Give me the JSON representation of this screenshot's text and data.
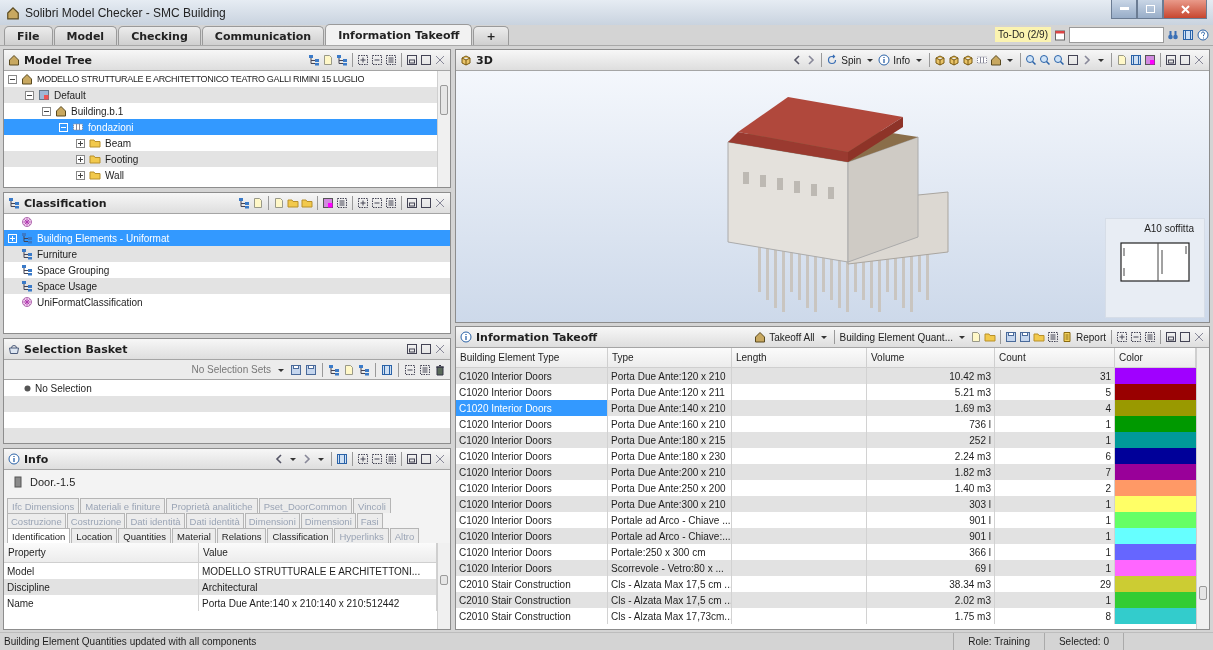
{
  "window": {
    "title": "Solibri Model Checker - SMC Building"
  },
  "menu_tabs": [
    {
      "label": "File",
      "selected": false
    },
    {
      "label": "Model",
      "selected": false
    },
    {
      "label": "Checking",
      "selected": false
    },
    {
      "label": "Communication",
      "selected": false
    },
    {
      "label": "Information Takeoff",
      "selected": true
    },
    {
      "label": "+",
      "selected": false
    }
  ],
  "todo": {
    "label": "To-Do (2/9)"
  },
  "model_tree": {
    "title": "Model Tree",
    "items": [
      {
        "label": "MODELLO STRUTTURALE E ARCHITETTONICO TEATRO GALLI RIMINI 15 LUGLIO",
        "kind": "model",
        "expanded": true,
        "selected": false,
        "children": [
          {
            "label": "Default",
            "kind": "layer",
            "expanded": true,
            "selected": false,
            "children": [
              {
                "label": "Building.b.1",
                "kind": "building",
                "expanded": true,
                "selected": false,
                "children": [
                  {
                    "label": "fondazioni",
                    "kind": "storey",
                    "expanded": true,
                    "selected": true,
                    "children": [
                      {
                        "label": "Beam",
                        "kind": "folder",
                        "expanded": false,
                        "selected": false
                      },
                      {
                        "label": "Footing",
                        "kind": "folder",
                        "expanded": false,
                        "selected": false
                      },
                      {
                        "label": "Wall",
                        "kind": "folder",
                        "expanded": false,
                        "selected": false
                      }
                    ]
                  }
                ]
              }
            ]
          }
        ]
      }
    ]
  },
  "classification": {
    "title": "Classification",
    "items": [
      {
        "kind": "set",
        "selected": false
      },
      {
        "label": "Building Elements - Uniformat",
        "kind": "group",
        "selected": true,
        "expanded": false
      },
      {
        "label": "Furniture",
        "kind": "group",
        "selected": false
      },
      {
        "label": "Space Grouping",
        "kind": "group",
        "selected": false
      },
      {
        "label": "Space Usage",
        "kind": "group",
        "selected": false
      },
      {
        "label": "UniFormatClassification",
        "kind": "set",
        "selected": false
      }
    ]
  },
  "selection_basket": {
    "title": "Selection Basket",
    "sets_dropdown": "No Selection Sets",
    "items": [
      {
        "label": "No Selection"
      }
    ]
  },
  "info": {
    "title": "Info",
    "object": "Door.-1.5",
    "tab_rows": [
      {
        "tabs": [
          {
            "label": "Ifc Dimensions",
            "disabled": true,
            "selected": false
          },
          {
            "label": "Materiali e finiture",
            "disabled": true,
            "selected": false
          },
          {
            "label": "Proprietà analitiche",
            "disabled": true,
            "selected": false
          },
          {
            "label": "Pset_DoorCommon",
            "disabled": true,
            "selected": false
          },
          {
            "label": "Vincoli",
            "disabled": true,
            "selected": false
          }
        ]
      },
      {
        "tabs": [
          {
            "label": "Costruzione",
            "disabled": true,
            "selected": false
          },
          {
            "label": "Costruzione",
            "disabled": true,
            "selected": false
          },
          {
            "label": "Dati identità",
            "disabled": true,
            "selected": false
          },
          {
            "label": "Dati identità",
            "disabled": true,
            "selected": false
          },
          {
            "label": "Dimensioni",
            "disabled": true,
            "selected": false
          },
          {
            "label": "Dimensioni",
            "disabled": true,
            "selected": false
          },
          {
            "label": "Fasi",
            "disabled": true,
            "selected": false
          }
        ]
      },
      {
        "tabs": [
          {
            "label": "Identification",
            "disabled": false,
            "selected": true
          },
          {
            "label": "Location",
            "disabled": false,
            "selected": false
          },
          {
            "label": "Quantities",
            "disabled": false,
            "selected": false
          },
          {
            "label": "Material",
            "disabled": false,
            "selected": false
          },
          {
            "label": "Relations",
            "disabled": false,
            "selected": false
          },
          {
            "label": "Classification",
            "disabled": false,
            "selected": false
          },
          {
            "label": "Hyperlinks",
            "disabled": true,
            "selected": false
          },
          {
            "label": "Altro",
            "disabled": true,
            "selected": false
          }
        ]
      }
    ],
    "columns": [
      "Property",
      "Value"
    ],
    "rows": [
      [
        "Model",
        "MODELLO STRUTTURALE E ARCHITETTONI..."
      ],
      [
        "Discipline",
        "Architectural"
      ],
      [
        "Name",
        "Porta Due Ante:140 x 210:140 x 210:512442"
      ]
    ]
  },
  "view_3d": {
    "title": "3D",
    "spin": "Spin",
    "info": "Info",
    "minimap": {
      "label": "A10 soffitta"
    }
  },
  "takeoff": {
    "title": "Information Takeoff",
    "takeoff_all": "Takeoff All",
    "preset": "Building Element Quant...",
    "report": "Report",
    "columns": [
      "Building Element Type",
      "Type",
      "Length",
      "Volume",
      "Count",
      "Color"
    ],
    "rows": [
      {
        "element": "C1020 Interior Doors",
        "type": "Porta Due Ante:120 x 210",
        "volume": "10.42 m3",
        "count": "31",
        "color": "#a000ff",
        "selected": false
      },
      {
        "element": "C1020 Interior Doors",
        "type": "Porta Due Ante:120 x 211",
        "volume": "5.21 m3",
        "count": "5",
        "color": "#990000",
        "selected": false
      },
      {
        "element": "C1020 Interior Doors",
        "type": "Porta Due Ante:140 x 210",
        "volume": "1.69 m3",
        "count": "4",
        "color": "#999900",
        "selected": true
      },
      {
        "element": "C1020 Interior Doors",
        "type": "Porta Due Ante:160 x 210",
        "volume": "736 l",
        "count": "1",
        "color": "#009900",
        "selected": false
      },
      {
        "element": "C1020 Interior Doors",
        "type": "Porta Due Ante:180 x 215",
        "volume": "252 l",
        "count": "1",
        "color": "#009999",
        "selected": false
      },
      {
        "element": "C1020 Interior Doors",
        "type": "Porta Due Ante:180 x 230",
        "volume": "2.24 m3",
        "count": "6",
        "color": "#000099",
        "selected": false
      },
      {
        "element": "C1020 Interior Doors",
        "type": "Porta Due Ante:200 x 210",
        "volume": "1.82 m3",
        "count": "7",
        "color": "#990099",
        "selected": false
      },
      {
        "element": "C1020 Interior Doors",
        "type": "Porta Due Ante:250 x 200",
        "volume": "1.40 m3",
        "count": "2",
        "color": "#ff9966",
        "selected": false
      },
      {
        "element": "C1020 Interior Doors",
        "type": "Porta Due Ante:300 x 210",
        "volume": "303 l",
        "count": "1",
        "color": "#ffff66",
        "selected": false
      },
      {
        "element": "C1020 Interior Doors",
        "type": "Portale ad Arco - Chiave ...",
        "volume": "901 l",
        "count": "1",
        "color": "#66ff66",
        "selected": false
      },
      {
        "element": "C1020 Interior Doors",
        "type": "Portale ad Arco - Chiave:...",
        "volume": "901 l",
        "count": "1",
        "color": "#66ffff",
        "selected": false
      },
      {
        "element": "C1020 Interior Doors",
        "type": "Portale:250 x 300 cm",
        "volume": "366 l",
        "count": "1",
        "color": "#6666ff",
        "selected": false
      },
      {
        "element": "C1020 Interior Doors",
        "type": "Scorrevole -  Vetro:80 x ...",
        "volume": "69 l",
        "count": "1",
        "color": "#ff66ff",
        "selected": false
      },
      {
        "element": "C2010 Stair Construction",
        "type": "Cls - Alzata Max 17,5 cm ...",
        "volume": "38.34 m3",
        "count": "29",
        "color": "#cccc33",
        "selected": false
      },
      {
        "element": "C2010 Stair Construction",
        "type": "Cls - Alzata Max 17,5 cm ...",
        "volume": "2.02 m3",
        "count": "1",
        "color": "#33cc33",
        "selected": false
      },
      {
        "element": "C2010 Stair Construction",
        "type": "Cls - Alzata Max 17,73cm...",
        "volume": "1.75 m3",
        "count": "8",
        "color": "#33cccc",
        "selected": false
      }
    ]
  },
  "status_bar": {
    "message": "Building Element Quantities updated with all components",
    "role": "Role: Training",
    "selected": "Selected: 0"
  }
}
